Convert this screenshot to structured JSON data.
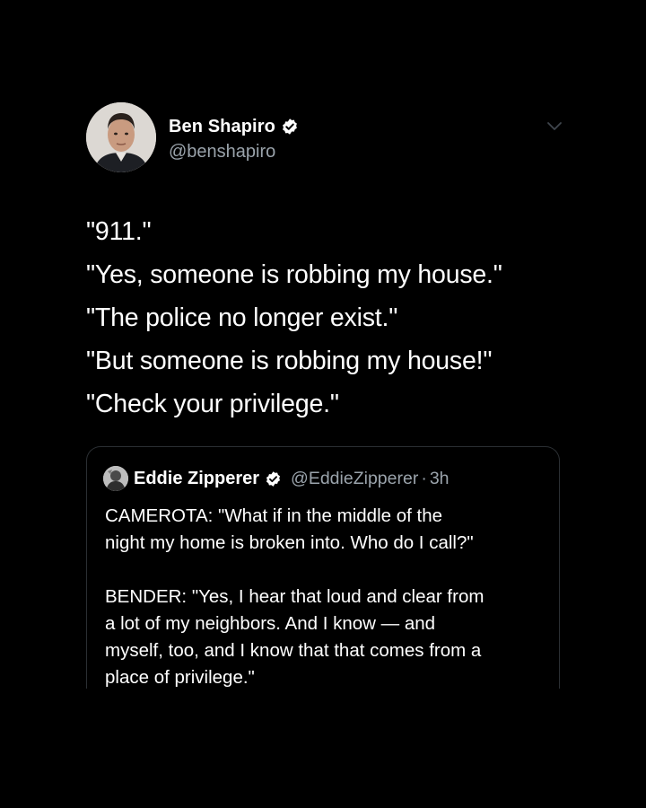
{
  "tweet": {
    "author": {
      "display_name": "Ben Shapiro",
      "handle": "@benshapiro",
      "verified_icon": "verified-badge-icon",
      "avatar_icon": "profile-photo"
    },
    "menu_icon": "chevron-down-icon",
    "lines": [
      "\"911.\"",
      "\"Yes, someone is robbing my house.\"",
      "\"The police no longer exist.\"",
      "\"But someone is robbing my house!\"",
      "\"Check your privilege.\""
    ]
  },
  "quoted_tweet": {
    "author": {
      "display_name": "Eddie Zipperer",
      "handle": "@EddieZipperer",
      "separator": "·",
      "time": "3h",
      "verified_icon": "verified-badge-icon"
    },
    "paragraph1": [
      "CAMEROTA: \"What if in the middle of the",
      "night my home is broken into. Who do I call?\""
    ],
    "paragraph2": [
      "BENDER: \"Yes, I hear that loud and clear from",
      "a lot of my neighbors. And I know — and",
      "myself, too, and I know that that comes from a",
      "place of privilege.\""
    ]
  },
  "colors": {
    "background": "#000000",
    "text": "#ffffff",
    "secondary_text": "#9aa3ab",
    "border": "#2b2f33"
  }
}
